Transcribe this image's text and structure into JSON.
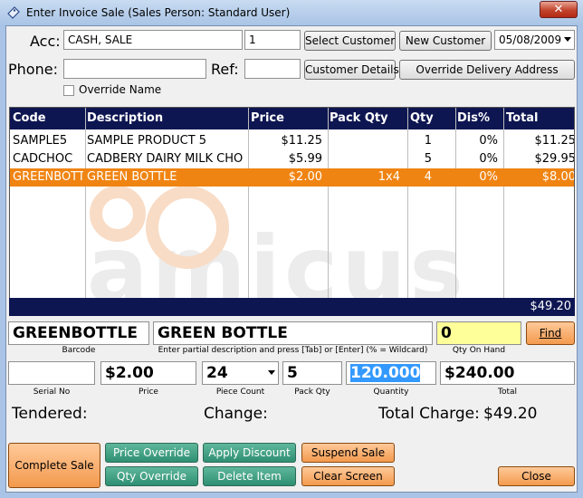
{
  "window": {
    "title": "Enter Invoice Sale (Sales Person: Standard User)",
    "close_glyph": "✕",
    "app_icon": "invoice-icon"
  },
  "customer": {
    "acc_label": "Acc:",
    "account": "CASH, SALE",
    "account_no": "1",
    "select_customer": "Select Customer",
    "new_customer": "New Customer",
    "date": "05/08/2009",
    "phone_label": "Phone:",
    "phone": "",
    "ref_label": "Ref:",
    "ref": "",
    "customer_details": "Customer Details",
    "override_delivery": "Override Delivery Address",
    "override_name_label": "Override Name",
    "override_name_checked": false
  },
  "grid": {
    "columns": [
      "Code",
      "Description",
      "Price",
      "Pack Qty",
      "Qty",
      "Dis%",
      "Total"
    ],
    "rows": [
      {
        "code": "SAMPLE5",
        "description": "SAMPLE PRODUCT 5",
        "price": "$11.25",
        "pack_qty": "",
        "qty": "1",
        "dis": "0%",
        "total": "$11.25"
      },
      {
        "code": "CADCHOC",
        "description": "CADBERY DAIRY MILK CHO",
        "price": "$5.99",
        "pack_qty": "",
        "qty": "5",
        "dis": "0%",
        "total": "$29.95"
      },
      {
        "code": "GREENBOTT",
        "description": "GREEN BOTTLE",
        "price": "$2.00",
        "pack_qty": "1x4",
        "qty": "4",
        "dis": "0%",
        "total": "$8.00"
      }
    ],
    "selected_row": 2,
    "grand_total": "$49.20"
  },
  "item": {
    "barcode": "GREENBOTTLE",
    "barcode_caption": "Barcode",
    "description": "GREEN BOTTLE",
    "description_caption": "Enter partial description and press [Tab] or [Enter] (% = Wildcard)",
    "qty_on_hand": "0",
    "qty_on_hand_caption": "Qty On Hand",
    "find_label": "Find",
    "serial_no": "",
    "serial_caption": "Serial No",
    "price": "$2.00",
    "price_caption": "Price",
    "piece_count": "24",
    "piece_caption": "Piece Count",
    "pack_qty": "5",
    "pack_qty_caption": "Pack Qty",
    "quantity": "120.000",
    "quantity_caption": "Quantity",
    "total": "$240.00",
    "total_caption": "Total"
  },
  "summary": {
    "tendered_label": "Tendered:",
    "change_label": "Change:",
    "total_charge_label": "Total Charge:",
    "total_charge": "$49.20"
  },
  "actions": {
    "complete_sale": "Complete Sale",
    "price_override": "Price Override",
    "qty_override": "Qty Override",
    "apply_discount": "Apply Discount",
    "delete_item": "Delete Item",
    "suspend_sale": "Suspend Sale",
    "clear_screen": "Clear Screen",
    "close": "Close"
  },
  "colors": {
    "grid_header": "#0e1652",
    "selected_row": "#f08412",
    "qty_on_hand_bg": "#ffff99",
    "quantity_highlight": "#3399ff",
    "orange_button": "#f39a4e",
    "green_button": "#2e8f72"
  }
}
